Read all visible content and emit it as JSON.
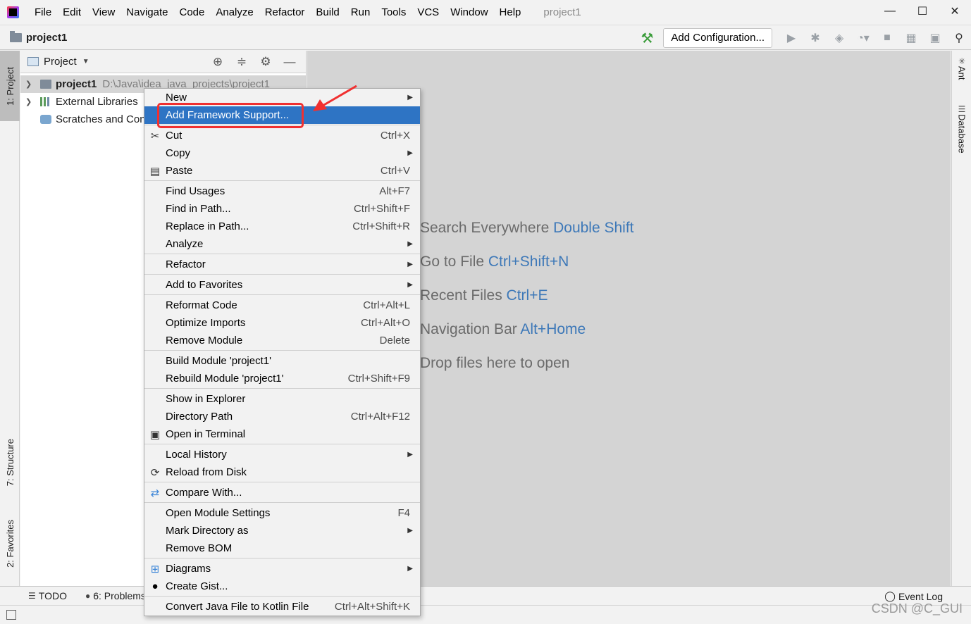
{
  "window": {
    "title": "project1",
    "minimize": "—",
    "maximize": "☐",
    "close": "✕"
  },
  "menubar": [
    "File",
    "Edit",
    "View",
    "Navigate",
    "Code",
    "Analyze",
    "Refactor",
    "Build",
    "Run",
    "Tools",
    "VCS",
    "Window",
    "Help"
  ],
  "navbar": {
    "project": "project1",
    "add_configuration": "Add Configuration..."
  },
  "left_strip": {
    "project_tab": "1: Project",
    "structure_tab": "7: Structure",
    "favorites_tab": "2: Favorites"
  },
  "right_strip": {
    "ant_tab": "Ant",
    "database_tab": "Database"
  },
  "project_panel": {
    "title": "Project",
    "tree": [
      {
        "name": "project1",
        "path": "D:\\Java\\idea_java_projects\\project1"
      },
      {
        "name": "External Libraries"
      },
      {
        "name": "Scratches and Consoles"
      }
    ]
  },
  "editor_hints": [
    {
      "text": "Search Everywhere ",
      "key": "Double Shift"
    },
    {
      "text": "Go to File ",
      "key": "Ctrl+Shift+N"
    },
    {
      "text": "Recent Files ",
      "key": "Ctrl+E"
    },
    {
      "text": "Navigation Bar ",
      "key": "Alt+Home"
    },
    {
      "text": "Drop files here to open",
      "key": ""
    }
  ],
  "context_menu": {
    "new": "New",
    "add_framework_support": "Add Framework Support...",
    "cut": "Cut",
    "cut_sc": "Ctrl+X",
    "copy": "Copy",
    "paste": "Paste",
    "paste_sc": "Ctrl+V",
    "find_usages": "Find Usages",
    "find_usages_sc": "Alt+F7",
    "find_in_path": "Find in Path...",
    "find_in_path_sc": "Ctrl+Shift+F",
    "replace_in_path": "Replace in Path...",
    "replace_in_path_sc": "Ctrl+Shift+R",
    "analyze": "Analyze",
    "refactor": "Refactor",
    "add_to_favorites": "Add to Favorites",
    "reformat_code": "Reformat Code",
    "reformat_code_sc": "Ctrl+Alt+L",
    "optimize_imports": "Optimize Imports",
    "optimize_imports_sc": "Ctrl+Alt+O",
    "remove_module": "Remove Module",
    "remove_module_sc": "Delete",
    "build_module": "Build Module 'project1'",
    "rebuild_module": "Rebuild Module 'project1'",
    "rebuild_module_sc": "Ctrl+Shift+F9",
    "show_in_explorer": "Show in Explorer",
    "directory_path": "Directory Path",
    "directory_path_sc": "Ctrl+Alt+F12",
    "open_in_terminal": "Open in Terminal",
    "local_history": "Local History",
    "reload_from_disk": "Reload from Disk",
    "compare_with": "Compare With...",
    "open_module_settings": "Open Module Settings",
    "open_module_settings_sc": "F4",
    "mark_directory_as": "Mark Directory as",
    "remove_bom": "Remove BOM",
    "diagrams": "Diagrams",
    "create_gist": "Create Gist...",
    "convert_kotlin": "Convert Java File to Kotlin File",
    "convert_kotlin_sc": "Ctrl+Alt+Shift+K"
  },
  "bottom": {
    "todo": "TODO",
    "problems": "6: Problems",
    "event_log": "Event Log"
  },
  "watermark": "CSDN @C_GUI"
}
